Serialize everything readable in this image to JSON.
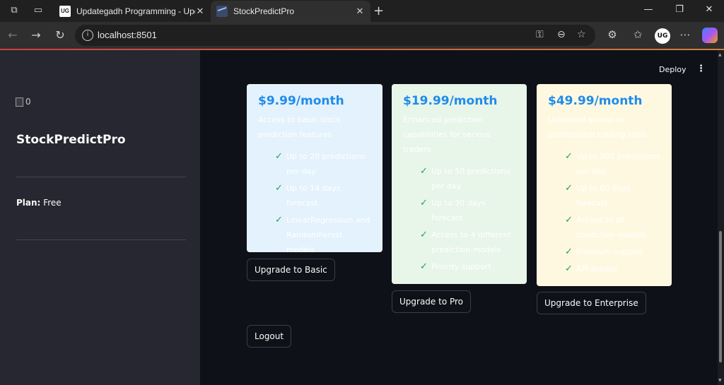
{
  "browser": {
    "tabs": [
      {
        "title": "Updategadh Programming - Upd",
        "favicon": "UG"
      },
      {
        "title": "StockPredictPro",
        "favicon": "chart-icon"
      }
    ],
    "url": "localhost:8501",
    "avatar_label": "UG"
  },
  "sidebar": {
    "image_alt": "0",
    "app_title": "StockPredictPro",
    "plan_label": "Plan:",
    "plan_value": "Free"
  },
  "header": {
    "deploy_label": "Deploy"
  },
  "plans": [
    {
      "price": "$9.99/month",
      "description": "Access to basic stock prediction features",
      "features": [
        "Up to 20 predictions per day",
        "Up to 14 days forecast",
        "LinearRegression and RandomForest models"
      ],
      "button_label": "Upgrade to Basic",
      "bg_color": "#e3f2fd"
    },
    {
      "price": "$19.99/month",
      "description": "Enhanced prediction capabilities for serious traders",
      "features": [
        "Up to 50 predictions per day",
        "Up to 30 days forecast",
        "Access to 4 different prediction models",
        "Priority support"
      ],
      "button_label": "Upgrade to Pro",
      "bg_color": "#e8f5e9"
    },
    {
      "price": "$49.99/month",
      "description": "Unlimited access to professional trading tools",
      "features": [
        "Up to 200 predictions per day",
        "Up to 60 days forecast",
        "Access to all prediction models",
        "Premium support",
        "API access"
      ],
      "button_label": "Upgrade to Enterprise",
      "bg_color": "#fff8e1"
    }
  ],
  "logout_label": "Logout",
  "colors": {
    "price": "#1f8ceb",
    "check": "#1aa64a",
    "sidebar_bg": "#262730",
    "main_bg": "#0e1117"
  }
}
